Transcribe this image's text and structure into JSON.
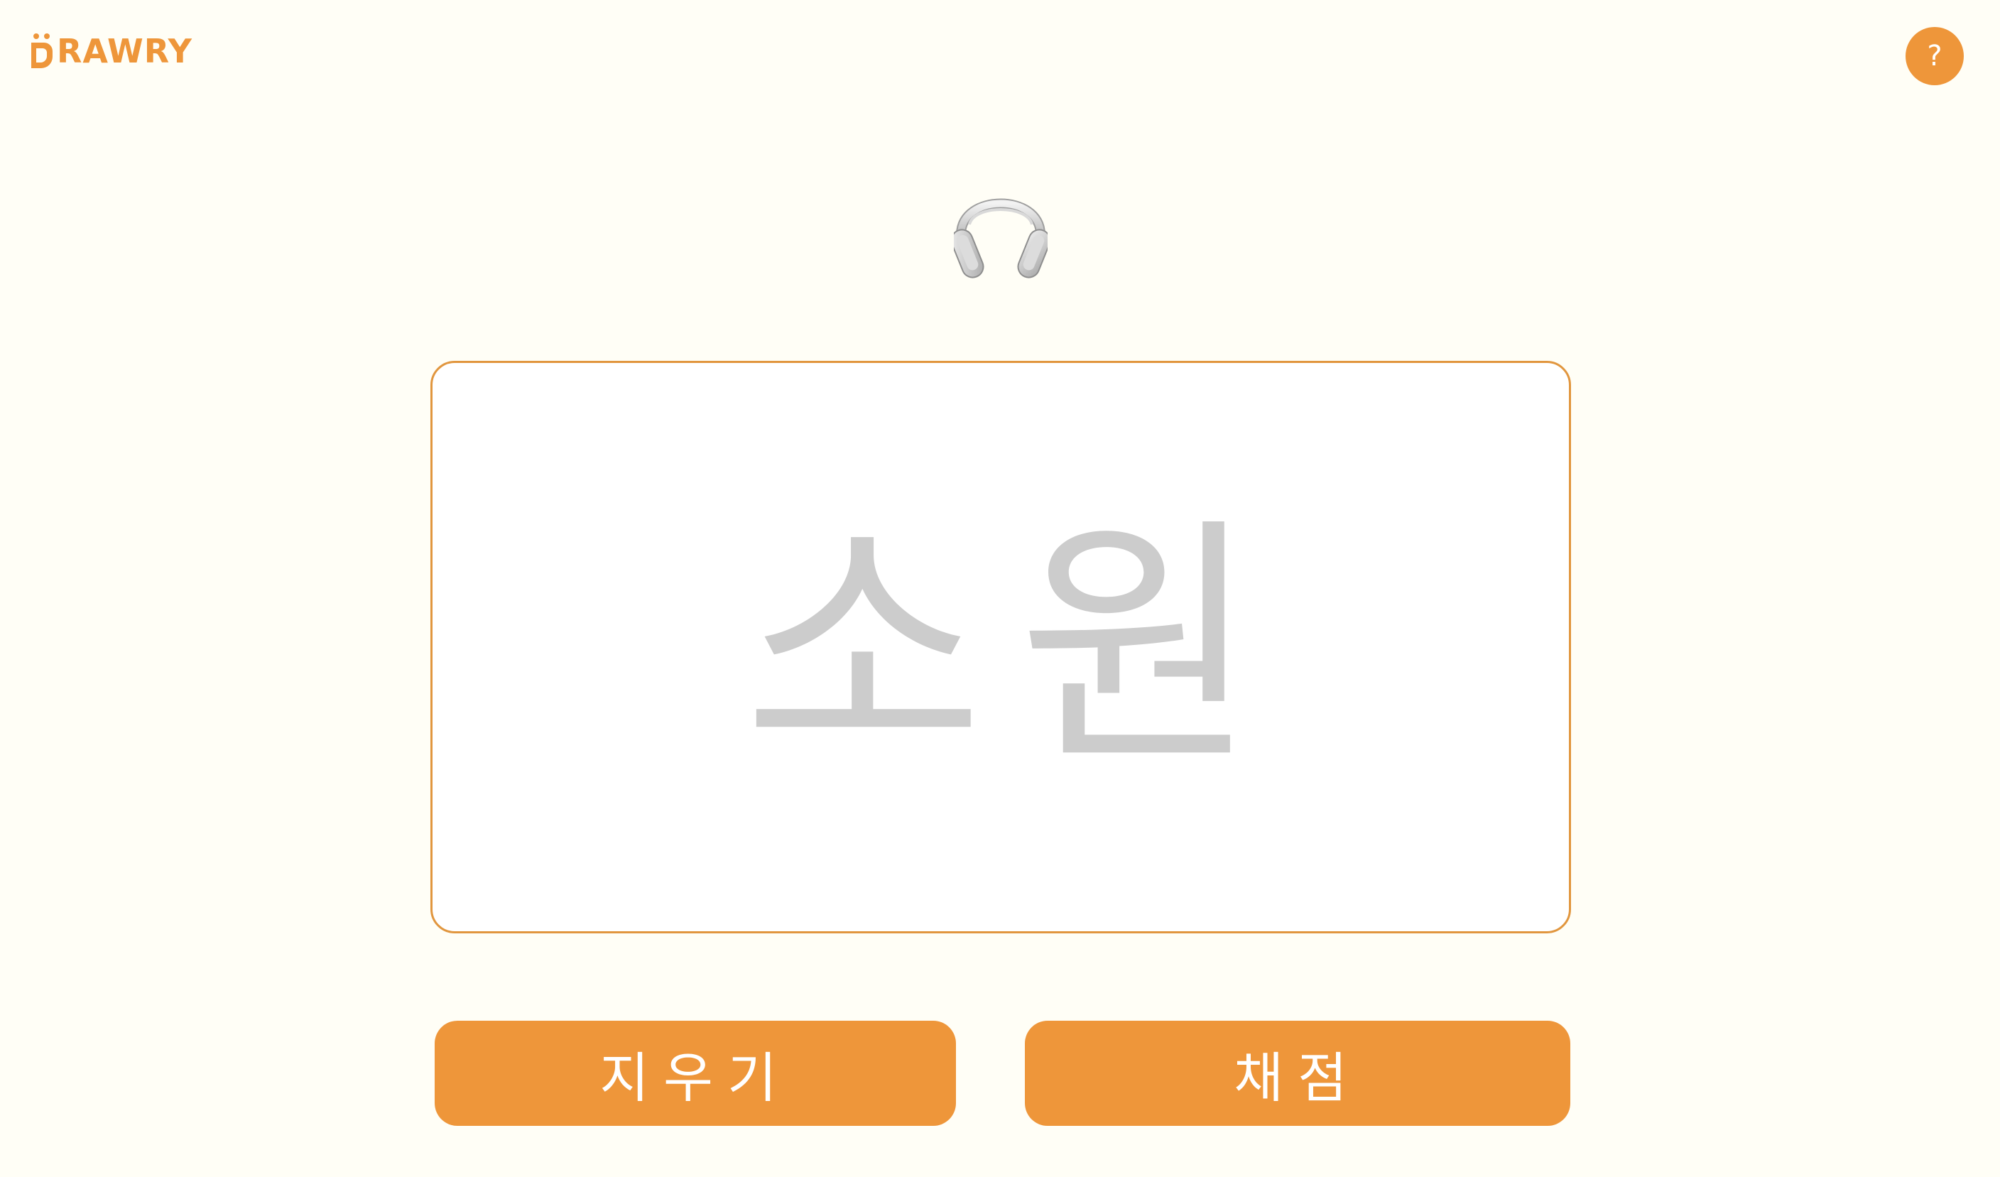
{
  "header": {
    "logo_text": "RAWRY",
    "help_label": "?"
  },
  "prompt": {
    "icon": "headphones-icon"
  },
  "canvas": {
    "guide_word": "소원"
  },
  "actions": {
    "erase_label": "지우기",
    "grade_label": "채점"
  },
  "colors": {
    "accent": "#EE963A",
    "canvas_border": "#E1963E",
    "background": "#FFFEF6",
    "guide_text": "#CCCCCC"
  }
}
